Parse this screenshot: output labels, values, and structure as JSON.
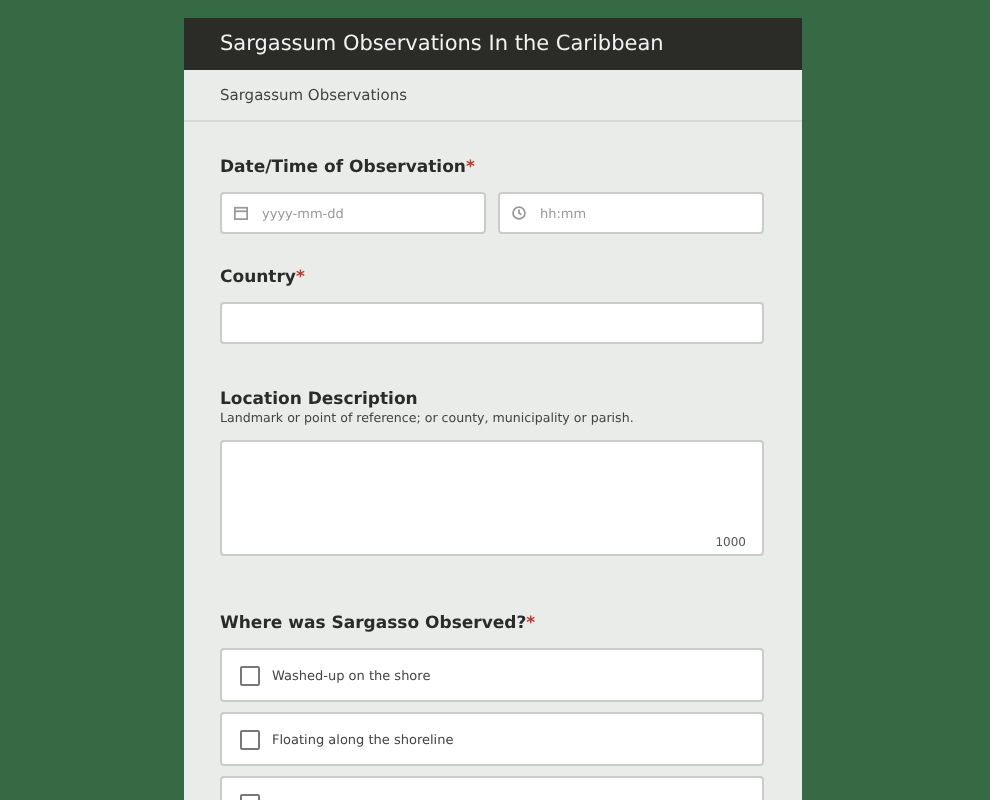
{
  "header": {
    "title": "Sargassum Observations In the Caribbean"
  },
  "subheader": {
    "text": "Sargassum Observations"
  },
  "questions": [
    {
      "kind": "datetime",
      "label": "Date/Time of Observation",
      "required_mark": "*",
      "date_placeholder": "yyyy-mm-dd",
      "time_placeholder": "hh:mm"
    },
    {
      "kind": "text",
      "label": "Country",
      "required_mark": "*"
    },
    {
      "kind": "textarea",
      "label": "Location Description",
      "hint": "Landmark or point of reference; or county, municipality or parish.",
      "counter": "1000"
    },
    {
      "kind": "checkboxes",
      "label": "Where was Sargasso Observed?",
      "required_mark": "*",
      "options": [
        {
          "label": "Washed-up on the shore",
          "checked": false
        },
        {
          "label": "Floating along the shoreline",
          "checked": false
        },
        {
          "checked": false
        }
      ]
    }
  ]
}
